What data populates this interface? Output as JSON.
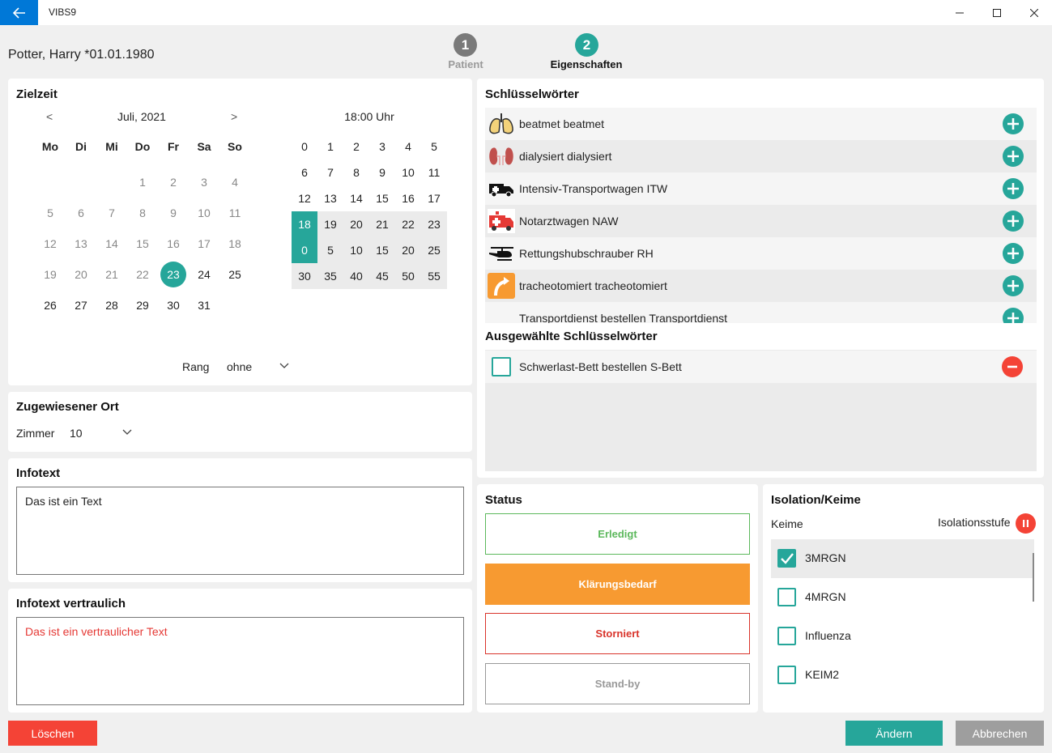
{
  "app": {
    "title": "VIBS9"
  },
  "patient": {
    "name": "Potter, Harry *01.01.1980"
  },
  "steps": [
    {
      "number": "1",
      "label": "Patient"
    },
    {
      "number": "2",
      "label": "Eigenschaften"
    }
  ],
  "zielzeit": {
    "title": "Zielzeit",
    "prev": "<",
    "next": ">",
    "month": "Juli, 2021",
    "weekdays": [
      "Mo",
      "Di",
      "Mi",
      "Do",
      "Fr",
      "Sa",
      "So"
    ],
    "selected_day": "23",
    "time_label": "18:00 Uhr",
    "hours": [
      "0",
      "1",
      "2",
      "3",
      "4",
      "5",
      "6",
      "7",
      "8",
      "9",
      "10",
      "11",
      "12",
      "13",
      "14",
      "15",
      "16",
      "17",
      "18",
      "19",
      "20",
      "21",
      "22",
      "23"
    ],
    "minutes": [
      "0",
      "5",
      "10",
      "15",
      "20",
      "25",
      "30",
      "35",
      "40",
      "45",
      "50",
      "55"
    ],
    "selected_hour": "18",
    "selected_minute": "0",
    "rang_label": "Rang",
    "rang_value": "ohne"
  },
  "ort": {
    "title": "Zugewiesener Ort",
    "zimmer_label": "Zimmer",
    "zimmer_value": "10"
  },
  "infotext": {
    "title": "Infotext",
    "value": "Das ist ein Text"
  },
  "infotext_vertraulich": {
    "title": "Infotext vertraulich",
    "value": "Das ist ein vertraulicher Text"
  },
  "schluesselwoerter": {
    "title": "Schlüsselwörter",
    "items": [
      {
        "label": "beatmet  beatmet",
        "icon": "lungs-icon"
      },
      {
        "label": "dialysiert  dialysiert",
        "icon": "kidney-icon"
      },
      {
        "label": "Intensiv-Transportwagen  ITW",
        "icon": "ambulance-icon"
      },
      {
        "label": "Notarztwagen  NAW",
        "icon": "emergency-vehicle-icon"
      },
      {
        "label": "Rettungshubschrauber  RH",
        "icon": "helicopter-icon"
      },
      {
        "label": "tracheotomiert  tracheotomiert",
        "icon": "trachea-icon"
      },
      {
        "label": "Transportdienst bestellen  Transportdienst",
        "icon": ""
      }
    ]
  },
  "ausgewaehlt": {
    "title": "Ausgewählte Schlüsselwörter",
    "items": [
      {
        "label": "Schwerlast-Bett bestellen  S-Bett"
      }
    ]
  },
  "status": {
    "title": "Status",
    "buttons": [
      {
        "label": "Erledigt",
        "color": "#5cb85c"
      },
      {
        "label": "Klärungsbedarf",
        "color": "#f79a31"
      },
      {
        "label": "Storniert",
        "color": "#d9342b"
      },
      {
        "label": "Stand-by",
        "color": "#999999"
      }
    ]
  },
  "isolation": {
    "title": "Isolation/Keime",
    "keime_label": "Keime",
    "stufe_label": "Isolationsstufe",
    "stufe_icon": "pause-icon",
    "keime": [
      {
        "label": "3MRGN",
        "checked": true
      },
      {
        "label": "4MRGN",
        "checked": false
      },
      {
        "label": "Influenza",
        "checked": false
      },
      {
        "label": "KEIM2",
        "checked": false
      }
    ]
  },
  "footer": {
    "delete": "Löschen",
    "change": "Ändern",
    "cancel": "Abbrechen"
  },
  "colors": {
    "accent": "#26a69a",
    "danger": "#f44336",
    "orange": "#f79a31",
    "titlebar_blue": "#0078d7"
  }
}
